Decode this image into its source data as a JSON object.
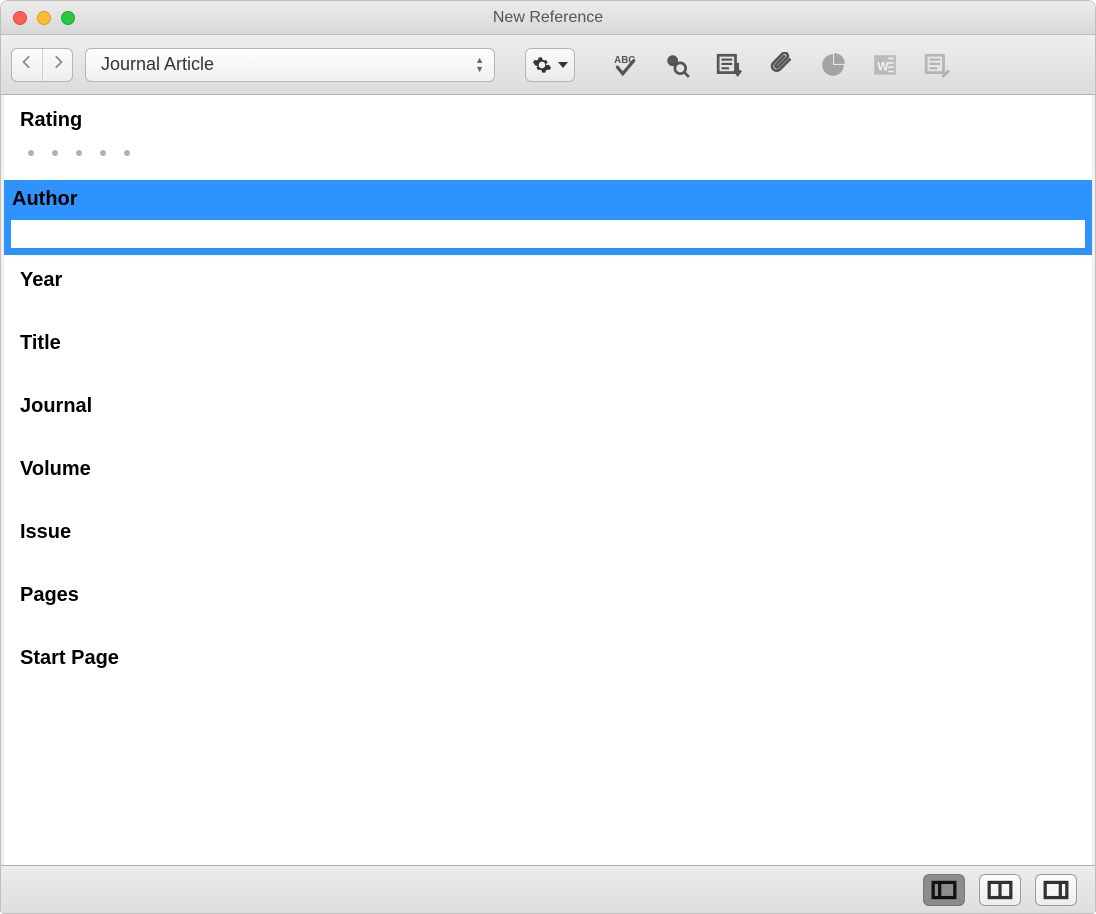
{
  "window": {
    "title": "New Reference"
  },
  "toolbar": {
    "reference_type": "Journal Article"
  },
  "fields": {
    "rating": {
      "label": "Rating"
    },
    "author": {
      "label": "Author",
      "value": ""
    },
    "year": {
      "label": "Year"
    },
    "title": {
      "label": "Title"
    },
    "journal": {
      "label": "Journal"
    },
    "volume": {
      "label": "Volume"
    },
    "issue": {
      "label": "Issue"
    },
    "pages": {
      "label": "Pages"
    },
    "startPage": {
      "label": "Start Page"
    }
  }
}
